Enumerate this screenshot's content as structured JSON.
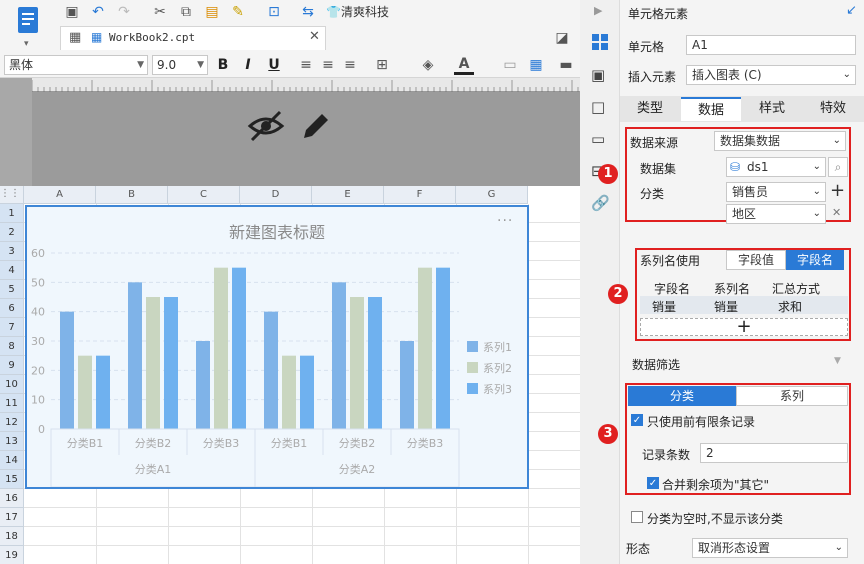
{
  "toolbar": {
    "company_label": "清爽科技",
    "file_tab": "WorkBook2.cpt",
    "font_name": "黑体",
    "font_size": "9.0",
    "bold": "B",
    "italic": "I",
    "underline": "U"
  },
  "sheet": {
    "columns": [
      "A",
      "B",
      "C",
      "D",
      "E",
      "F",
      "G"
    ],
    "rows": [
      "1",
      "2",
      "3",
      "4",
      "5",
      "6",
      "7",
      "8",
      "9",
      "10",
      "11",
      "12",
      "13",
      "14",
      "15",
      "16",
      "17",
      "18",
      "19"
    ]
  },
  "chart_data": {
    "type": "bar",
    "title": "新建图表标题",
    "categories": [
      "分类B1",
      "分类B2",
      "分类B3",
      "分类B1",
      "分类B2",
      "分类B3"
    ],
    "groups": [
      "分类A1",
      "分类A2"
    ],
    "ylim": [
      0,
      60
    ],
    "yticks": [
      "0",
      "10",
      "20",
      "30",
      "40",
      "50",
      "60"
    ],
    "series": [
      {
        "name": "系列1",
        "color": "#7fb3e8",
        "values": [
          40,
          50,
          30,
          40,
          50,
          30
        ]
      },
      {
        "name": "系列2",
        "color": "#c9d6c0",
        "values": [
          25,
          45,
          55,
          25,
          45,
          55
        ]
      },
      {
        "name": "系列3",
        "color": "#6fb1ef",
        "values": [
          25,
          45,
          55,
          25,
          45,
          55
        ]
      }
    ],
    "legend": "right",
    "more": "···"
  },
  "panel": {
    "title": "单元格元素",
    "cell_label": "单元格",
    "cell_value": "A1",
    "insert_label": "插入元素",
    "insert_value": "插入图表 (C)",
    "tabs": [
      "类型",
      "数据",
      "样式",
      "特效"
    ],
    "datasource_label": "数据来源",
    "datasource_value": "数据集数据",
    "dataset_label": "数据集",
    "dataset_value": "ds1",
    "category_label": "分类",
    "category_value": "销售员",
    "category_value2": "地区",
    "seriesname_label": "系列名使用",
    "seriesname_opt1": "字段值",
    "seriesname_opt2": "字段名",
    "table_headers": [
      "字段名",
      "系列名",
      "汇总方式"
    ],
    "table_row": [
      "销量",
      "销量",
      "求和"
    ],
    "add": "+",
    "filter_label": "数据筛选",
    "filter_tab1": "分类",
    "filter_tab2": "系列",
    "use_top_label": "只使用前有限条记录",
    "record_count_label": "记录条数",
    "record_count_value": "2",
    "merge_label": "合并剩余项为\"其它\"",
    "empty_label": "分类为空时,不显示该分类",
    "shape_label": "形态",
    "shape_value": "取消形态设置",
    "badges": [
      "1",
      "2",
      "3"
    ]
  }
}
